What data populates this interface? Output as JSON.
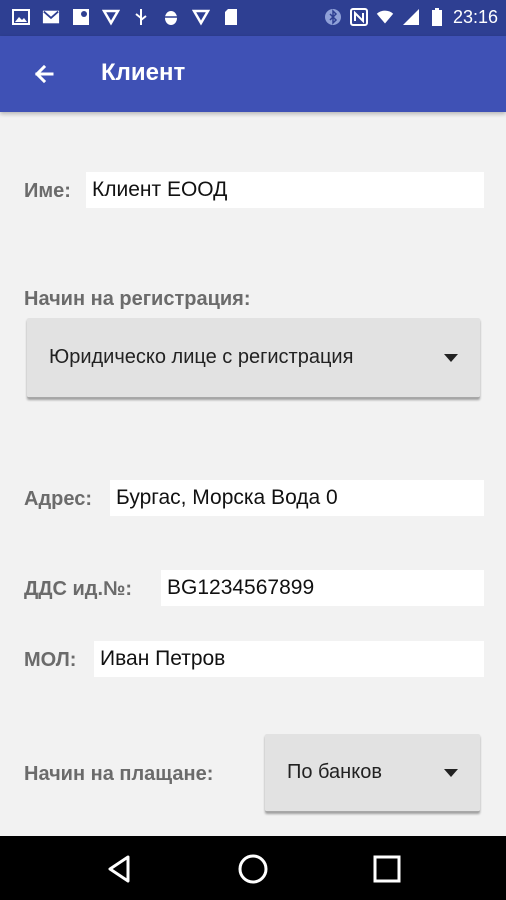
{
  "status_bar": {
    "time": "23:16",
    "left_icons": [
      "image-icon",
      "gmail-icon",
      "maps-icon",
      "cloud-check-icon",
      "usb-icon",
      "android-debug-icon",
      "cloud-check-icon",
      "sd-card-icon"
    ],
    "right_icons": [
      "bluetooth-icon",
      "nfc-icon",
      "wifi-icon",
      "signal-icon",
      "battery-icon"
    ]
  },
  "app_bar": {
    "title": "Клиент"
  },
  "form": {
    "name_label": "Име:",
    "name_value": "Клиент ЕООД",
    "registration_label": "Начин на регистрация:",
    "registration_value": "Юридическо лице с регистрация",
    "address_label": "Адрес:",
    "address_value": "Бургас, Морска Вода 0",
    "vat_label": "ДДС ид.№:",
    "vat_value": "BG1234567899",
    "mol_label": "МОЛ:",
    "mol_value": "Иван Петров",
    "payment_label": "Начин на плащане:",
    "payment_value": "По банков"
  },
  "nav_bar": {
    "icons": [
      "back-triangle-icon",
      "home-circle-icon",
      "recents-square-icon"
    ]
  },
  "colors": {
    "status_bar": "#2e3f92",
    "app_bar": "#3f51b5",
    "background": "#f2f2f2",
    "label": "#6b6b6b"
  }
}
